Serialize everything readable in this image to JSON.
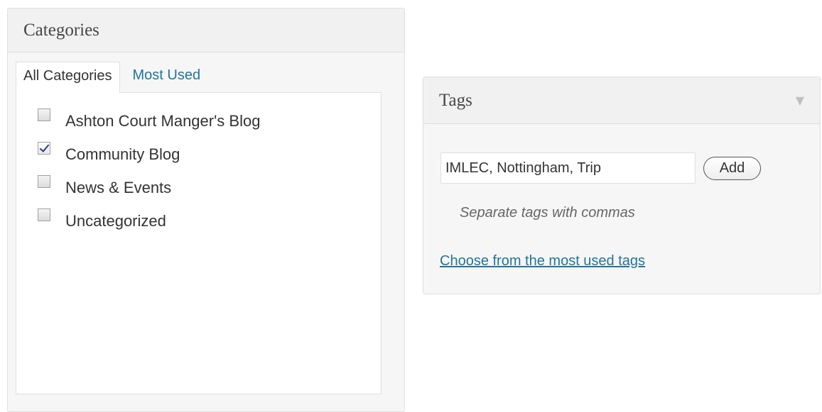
{
  "categories_box": {
    "title": "Categories",
    "tabs": [
      {
        "label": "All Categories",
        "active": true
      },
      {
        "label": "Most Used",
        "active": false
      }
    ],
    "items": [
      {
        "label": "Ashton Court Manger's Blog",
        "checked": false
      },
      {
        "label": "Community Blog",
        "checked": true
      },
      {
        "label": "News & Events",
        "checked": false
      },
      {
        "label": "Uncategorized",
        "checked": false
      }
    ]
  },
  "tags_box": {
    "title": "Tags",
    "toggle_icon": "triangle-down-icon",
    "input_value": "IMLEC, Nottingham, Trip",
    "add_label": "Add",
    "hint": "Separate tags with commas",
    "cloud_link": "Choose from the most used tags"
  },
  "colors": {
    "link": "#21759b",
    "panel_bg": "#f6f6f6",
    "border": "#dfdfdf",
    "checkmark": "#2a3f8f"
  }
}
